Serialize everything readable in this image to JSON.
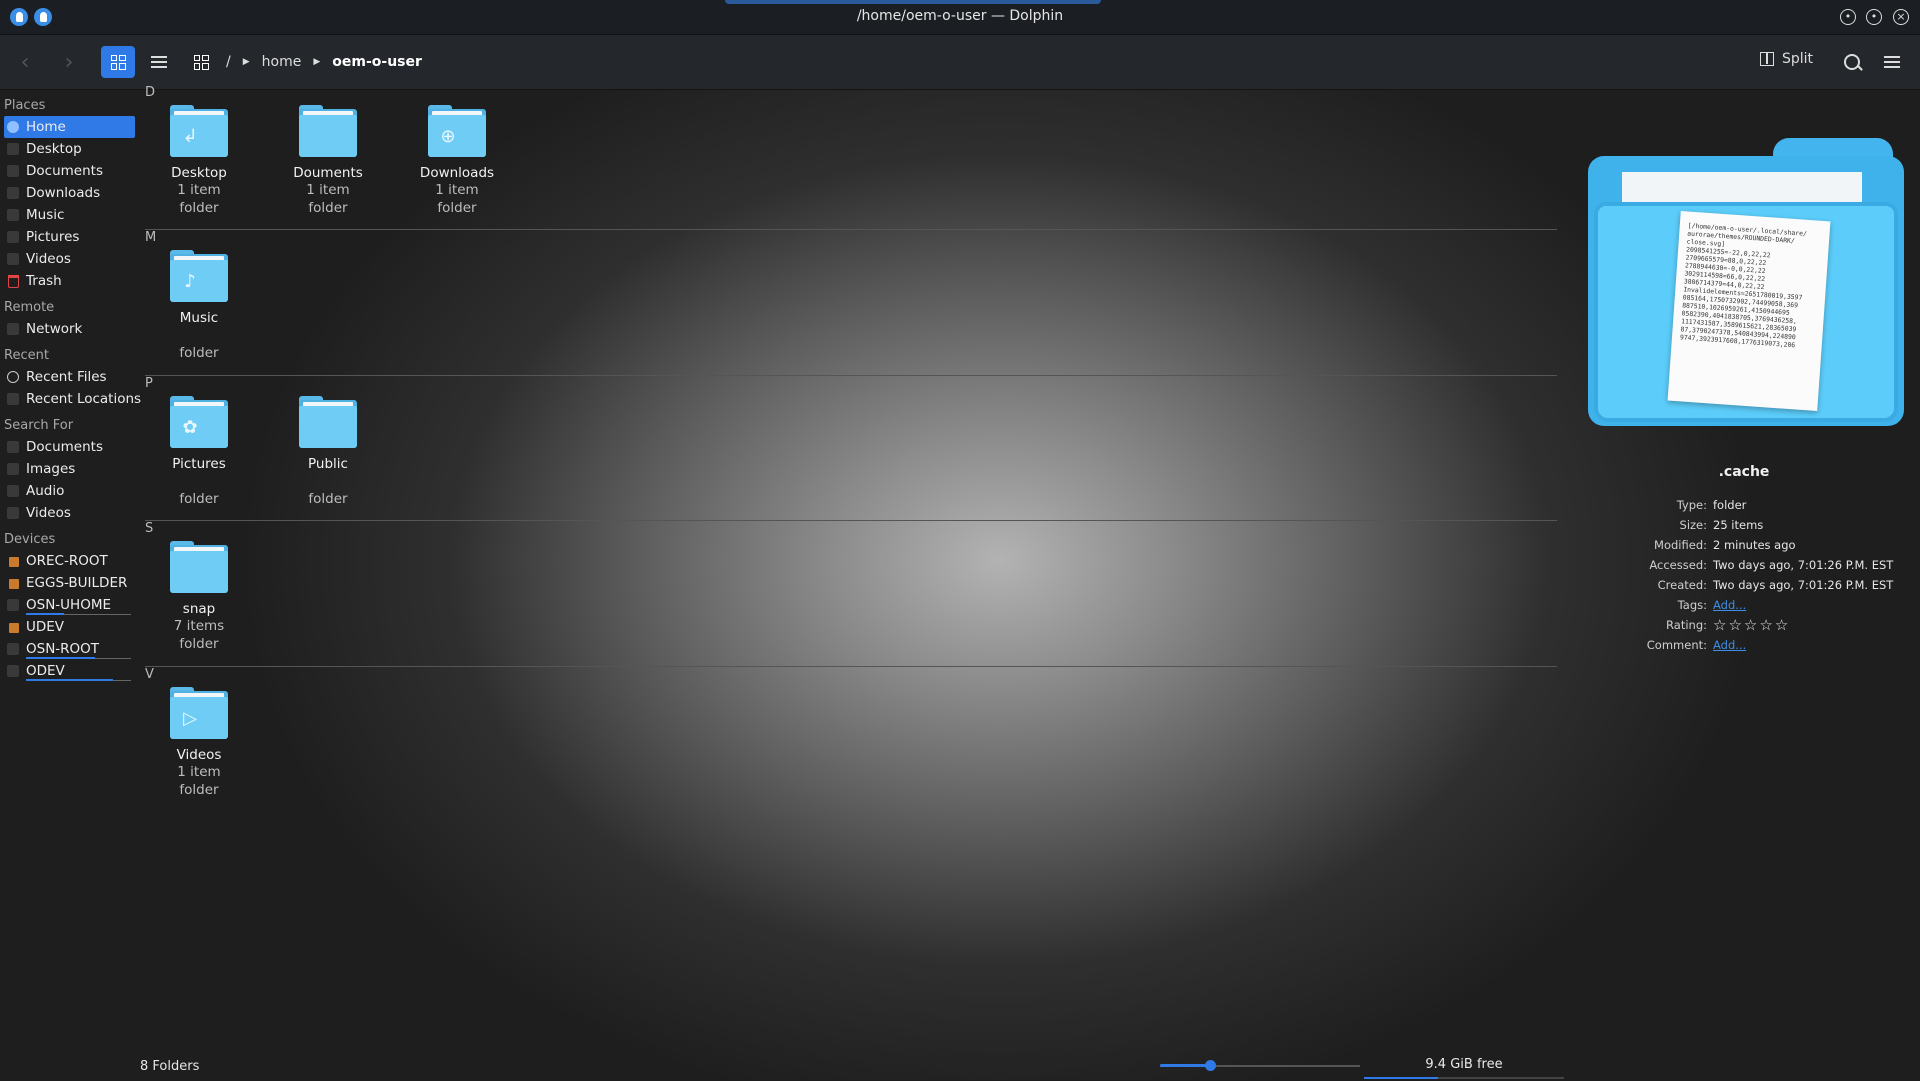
{
  "window": {
    "title": "/home/oem-o-user — Dolphin"
  },
  "toolbar": {
    "breadcrumb": [
      {
        "label": "/",
        "current": false
      },
      {
        "label": "home",
        "current": false
      },
      {
        "label": "oem-o-user",
        "current": true
      }
    ],
    "split_label": "Split",
    "view_mode": "icons"
  },
  "sidebar": {
    "sections": [
      {
        "title": "Places",
        "items": [
          {
            "label": "Home",
            "icon": "home-icon",
            "selected": true
          },
          {
            "label": "Desktop",
            "icon": "desktop-icon"
          },
          {
            "label": "Documents",
            "icon": "documents-icon"
          },
          {
            "label": "Downloads",
            "icon": "downloads-icon"
          },
          {
            "label": "Music",
            "icon": "music-icon"
          },
          {
            "label": "Pictures",
            "icon": "pictures-icon"
          },
          {
            "label": "Videos",
            "icon": "videos-icon"
          },
          {
            "label": "Trash",
            "icon": "trash-icon"
          }
        ]
      },
      {
        "title": "Remote",
        "items": [
          {
            "label": "Network",
            "icon": "network-icon"
          }
        ]
      },
      {
        "title": "Recent",
        "items": [
          {
            "label": "Recent Files",
            "icon": "clock-icon"
          },
          {
            "label": "Recent Locations",
            "icon": "recent-locations-icon"
          }
        ]
      },
      {
        "title": "Search For",
        "items": [
          {
            "label": "Documents",
            "icon": "documents-icon"
          },
          {
            "label": "Images",
            "icon": "images-icon"
          },
          {
            "label": "Audio",
            "icon": "audio-icon"
          },
          {
            "label": "Videos",
            "icon": "videos-icon"
          }
        ]
      },
      {
        "title": "Devices",
        "items": [
          {
            "label": "OREC-ROOT",
            "icon": "drive-icon"
          },
          {
            "label": "EGGS-BUILDER",
            "icon": "drive-icon"
          },
          {
            "label": "OSN-UHOME",
            "icon": "partition-icon",
            "usage": 0.36
          },
          {
            "label": "UDEV",
            "icon": "drive-icon"
          },
          {
            "label": "OSN-ROOT",
            "icon": "partition-icon",
            "usage": 0.66
          },
          {
            "label": "ODEV",
            "icon": "partition-icon",
            "usage": 0.83
          }
        ]
      }
    ]
  },
  "content": {
    "groups": [
      {
        "letter": "D",
        "items": [
          {
            "name": "Desktop",
            "count": "1 item",
            "type": "folder",
            "glyph": "desktop-folder-icon"
          },
          {
            "name": "Douments",
            "count": "1 item",
            "type": "folder",
            "glyph": "documents-folder-icon"
          },
          {
            "name": "Downloads",
            "count": "1 item",
            "type": "folder",
            "glyph": "downloads-folder-icon"
          }
        ]
      },
      {
        "letter": "M",
        "items": [
          {
            "name": "Music",
            "count": "",
            "type": "folder",
            "glyph": "music-folder-icon"
          }
        ]
      },
      {
        "letter": "P",
        "items": [
          {
            "name": "Pictures",
            "count": "",
            "type": "folder",
            "glyph": "pictures-folder-icon"
          },
          {
            "name": "Public",
            "count": "",
            "type": "folder",
            "glyph": "public-folder-icon"
          }
        ]
      },
      {
        "letter": "S",
        "items": [
          {
            "name": "snap",
            "count": "7 items",
            "type": "folder",
            "glyph": "folder-icon"
          }
        ]
      },
      {
        "letter": "V",
        "items": [
          {
            "name": "Videos",
            "count": "1 item",
            "type": "folder",
            "glyph": "videos-folder-icon"
          }
        ]
      }
    ]
  },
  "info_panel": {
    "name": ".cache",
    "preview_lines": [
      "[/home/oem-o-user/.local/share/",
      "aurorae/themes/ROUNDED-DARK/",
      "close.svg]",
      "2098541255=-22,0,22,22",
      "2709665579=88,0,22,22",
      "2788944630=-0,0,22,22",
      "3029114598=66,0,22,22",
      "3806714379=44,0,22,22",
      "Invalidelements=2651780019,3597",
      "085164,1750732902,74499058,369",
      "887510,1026959261,4150944695",
      "0582390,4041838705,3769436258,",
      "1117431587,3589615621,28365039",
      "87,3790247378,540843994,224890",
      "9747,3923917608,1776319073,206"
    ],
    "rows": [
      {
        "key": "Type:",
        "value": "folder"
      },
      {
        "key": "Size:",
        "value": "25 items"
      },
      {
        "key": "Modified:",
        "value": "2 minutes ago"
      },
      {
        "key": "Accessed:",
        "value": "Two days ago, 7:01:26 P.M. EST"
      },
      {
        "key": "Created:",
        "value": "Two days ago, 7:01:26 P.M. EST"
      },
      {
        "key": "Tags:",
        "value": "Add...",
        "link": true
      },
      {
        "key": "Rating:",
        "rating": 0,
        "rating_max": 5
      },
      {
        "key": "Comment:",
        "value": "Add...",
        "link": true
      }
    ]
  },
  "statusbar": {
    "text": "8 Folders",
    "zoom_level": 0.25,
    "free_space_label": "9.4 GiB free",
    "used_fraction": 0.37
  },
  "colors": {
    "accent": "#2f7ae6",
    "folder": "#6fcdf5",
    "trash": "#e04444"
  }
}
